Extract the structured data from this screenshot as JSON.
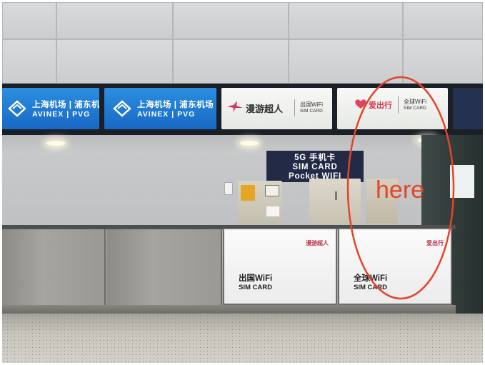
{
  "scene": {
    "overhead_signs": [
      {
        "type": "airport",
        "cn": "上海机场 | 浦东机场",
        "en": "AVINEX | PVG"
      },
      {
        "type": "airport",
        "cn": "上海机场 | 浦东机场",
        "en": "AVINEX | PVG"
      },
      {
        "type": "brand",
        "brand": "漫游超人",
        "service_cn": "出国WiFi",
        "service_en": "SIM CARD"
      },
      {
        "type": "brand",
        "brand": "爱出行",
        "service_cn": "全球WiFi",
        "service_en": "SIM CARD"
      }
    ],
    "center_sign": {
      "line1": "5G 手机卡",
      "line2": "SIM CARD",
      "line3": "Pocket WIFI"
    },
    "counter_panels": [
      {
        "brand": "漫游超人",
        "line1": "出国WiFi",
        "line2": "SIM CARD"
      },
      {
        "brand": "爱出行",
        "line1": "全球WiFi",
        "line2": "SIM CARD"
      }
    ]
  },
  "annotation": {
    "text": "here",
    "color": "#e3442a"
  },
  "colors": {
    "sign_blue": "#1f7ad4",
    "annotation_red": "#e3442a"
  }
}
